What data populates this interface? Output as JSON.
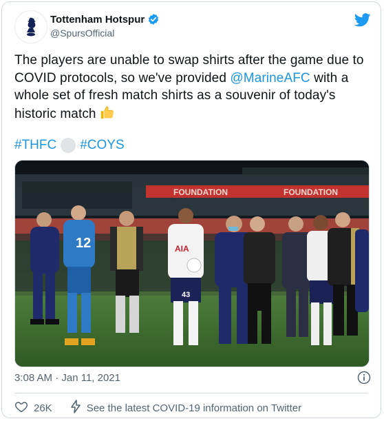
{
  "tweet": {
    "display_name": "Tottenham Hotspur",
    "handle": "@SpursOfficial",
    "text_before": "The players are unable to swap shirts after the game due to COVID protocols, so we've provided ",
    "mention": "@MarineAFC",
    "text_after": " with a whole set of fresh match shirts as a souvenir of today's historic match ",
    "hashtag_1": "#THFC",
    "hashtag_2": "#COYS",
    "timestamp": "3:08 AM · Jan 11, 2021",
    "like_count": "26K",
    "covid_link": "See the latest COVID-19 information on Twitter"
  },
  "photo": {
    "banner_text_1": "FOUNDATION",
    "banner_text_2": "FOUNDATION",
    "keeper_number": "12",
    "player_number": "43",
    "sponsor": "AIA"
  },
  "icons": {
    "avatar": "spurs-cockerel-icon",
    "verified": "verified-badge-icon",
    "brand": "twitter-bird-icon",
    "thumbs_up": "thumbs-up-emoji",
    "circle": "white-circle-emoji",
    "info": "info-icon",
    "like": "heart-icon",
    "covid": "lightning-icon"
  },
  "colors": {
    "link": "#1b95e0",
    "twitter_blue": "#1d9bf0",
    "text": "#0f1419",
    "muted": "#536471"
  }
}
